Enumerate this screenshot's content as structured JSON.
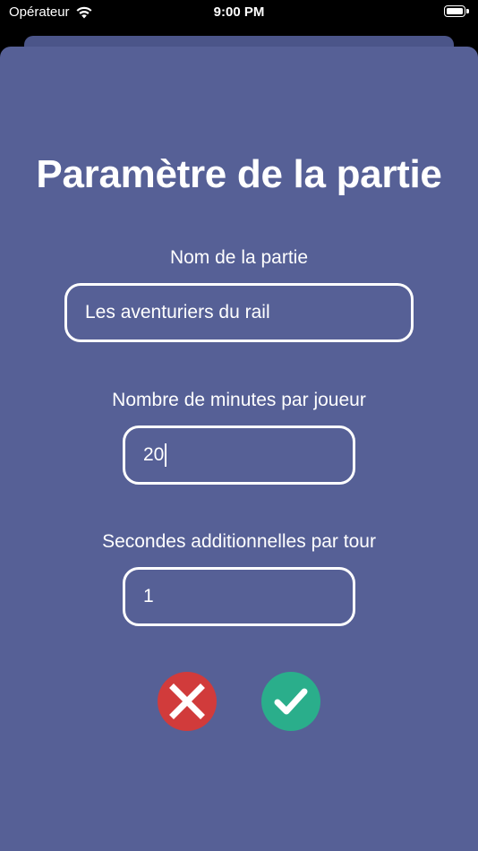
{
  "status_bar": {
    "carrier": "Opérateur",
    "time": "9:00 PM"
  },
  "form": {
    "title": "Paramètre de la partie",
    "fields": [
      {
        "label": "Nom de la partie",
        "value": "Les aventuriers du rail"
      },
      {
        "label": "Nombre de minutes par joueur",
        "value": "20"
      },
      {
        "label": "Secondes additionnelles par tour",
        "value": "1"
      }
    ]
  },
  "actions": {
    "cancel_icon": "close-icon",
    "confirm_icon": "checkmark-icon"
  },
  "colors": {
    "sheet_background": "#566096",
    "cancel": "#d13b3b",
    "confirm": "#2aae8b"
  }
}
